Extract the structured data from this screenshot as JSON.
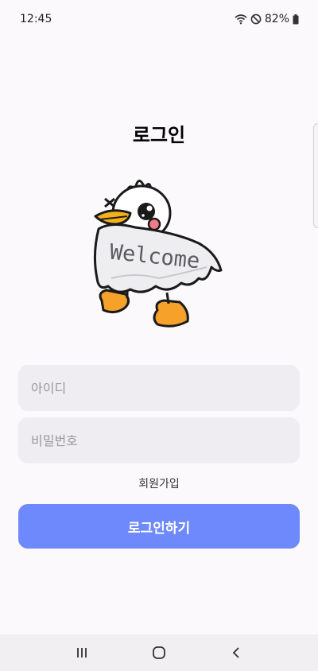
{
  "status_bar": {
    "time": "12:45",
    "battery_percent": "82%",
    "icons": [
      "wifi-icon",
      "do-not-disturb-icon",
      "battery-icon"
    ]
  },
  "page": {
    "title": "로그인"
  },
  "mascot": {
    "icon": "duck-ghost-mascot",
    "sign_text": "Welcome"
  },
  "form": {
    "id_placeholder": "아이디",
    "password_placeholder": "비밀번호",
    "signup_label": "회원가입",
    "login_label": "로그인하기"
  },
  "navigation": {
    "icons": [
      "recent-apps-icon",
      "home-icon",
      "back-icon"
    ]
  },
  "colors": {
    "background": "#fcf9fc",
    "field_background": "#efedf1",
    "primary": "#6e89fc",
    "beak": "#f5a623",
    "cheek": "#f07a8a"
  }
}
